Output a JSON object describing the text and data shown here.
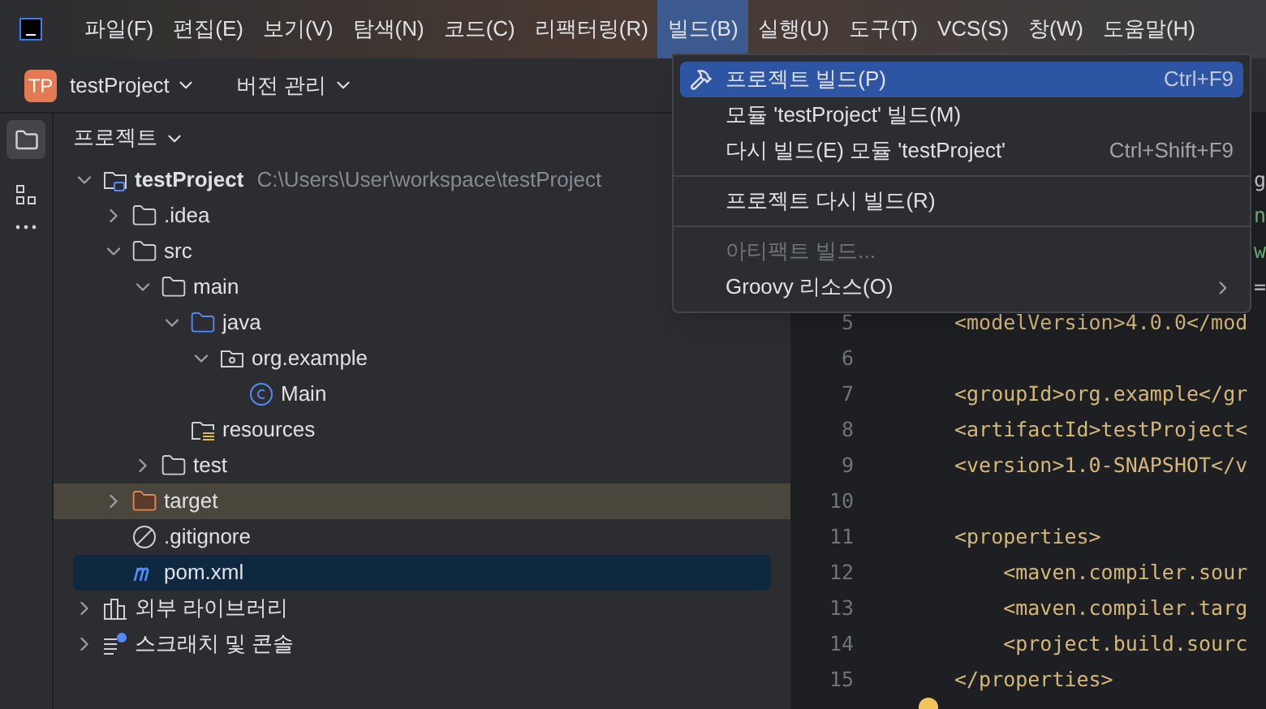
{
  "menu_bar": [
    {
      "label": "파일(F)",
      "selected": false
    },
    {
      "label": "편집(E)",
      "selected": false
    },
    {
      "label": "보기(V)",
      "selected": false
    },
    {
      "label": "탐색(N)",
      "selected": false
    },
    {
      "label": "코드(C)",
      "selected": false
    },
    {
      "label": "리팩터링(R)",
      "selected": false
    },
    {
      "label": "빌드(B)",
      "selected": true
    },
    {
      "label": "실행(U)",
      "selected": false
    },
    {
      "label": "도구(T)",
      "selected": false
    },
    {
      "label": "VCS(S)",
      "selected": false
    },
    {
      "label": "창(W)",
      "selected": false
    },
    {
      "label": "도움말(H)",
      "selected": false
    }
  ],
  "toolbar": {
    "project_badge": "TP",
    "project_name": "testProject",
    "vcs": "버전 관리"
  },
  "project_panel": {
    "title": "프로젝트",
    "tree": [
      {
        "name": "testProject",
        "path": "C:\\Users\\User\\workspace\\testProject",
        "kind": "module",
        "expanded": true,
        "selected": false,
        "excluded": false,
        "children": [
          {
            "name": ".idea",
            "kind": "folder",
            "expanded": false,
            "selected": false,
            "excluded": false
          },
          {
            "name": "src",
            "kind": "folder",
            "expanded": true,
            "selected": false,
            "excluded": false,
            "children": [
              {
                "name": "main",
                "kind": "folder",
                "expanded": true,
                "selected": false,
                "excluded": false,
                "children": [
                  {
                    "name": "java",
                    "kind": "source",
                    "expanded": true,
                    "selected": false,
                    "excluded": false,
                    "children": [
                      {
                        "name": "org.example",
                        "kind": "package",
                        "expanded": true,
                        "selected": false,
                        "excluded": false,
                        "children": [
                          {
                            "name": "Main",
                            "kind": "class",
                            "selected": false,
                            "excluded": false
                          }
                        ]
                      }
                    ]
                  },
                  {
                    "name": "resources",
                    "kind": "resources",
                    "selected": false,
                    "excluded": false
                  }
                ]
              },
              {
                "name": "test",
                "kind": "folder",
                "expanded": false,
                "selected": false,
                "excluded": false
              }
            ]
          },
          {
            "name": "target",
            "kind": "excluded",
            "expanded": false,
            "selected": false,
            "excluded": true
          },
          {
            "name": ".gitignore",
            "kind": "ignore",
            "selected": false,
            "excluded": false
          },
          {
            "name": "pom.xml",
            "kind": "maven",
            "selected": true,
            "excluded": false
          }
        ]
      },
      {
        "name": "외부 라이브러리",
        "kind": "library",
        "expanded": false,
        "selected": false,
        "excluded": false
      },
      {
        "name": "스크래치 및 콘솔",
        "kind": "scratch",
        "expanded": false,
        "selected": false,
        "excluded": false
      }
    ]
  },
  "editor": {
    "lines": [
      {
        "text": "g",
        "kind": "fragment"
      },
      {
        "text": "n",
        "kind": "fragment-green"
      },
      {
        "text": "w",
        "kind": "fragment-green"
      },
      {
        "text": "=",
        "kind": "fragment"
      },
      {
        "number": "5",
        "text": "<modelVersion>4.0.0</mod",
        "kind": "code"
      },
      {
        "number": "6",
        "kind": "code"
      },
      {
        "number": "7",
        "text": "<groupId>org.example</gr",
        "kind": "code"
      },
      {
        "number": "8",
        "text": "<artifactId>testProject<",
        "kind": "code"
      },
      {
        "number": "9",
        "text": "<version>1.0-SNAPSHOT</v",
        "kind": "code"
      },
      {
        "number": "10",
        "kind": "code"
      },
      {
        "number": "11",
        "text": "<properties>",
        "kind": "code"
      },
      {
        "number": "12",
        "text": "    <maven.compiler.sour",
        "kind": "code"
      },
      {
        "number": "13",
        "text": "    <maven.compiler.targ",
        "kind": "code"
      },
      {
        "number": "14",
        "text": "    <project.build.sourc",
        "kind": "code"
      },
      {
        "number": "15",
        "text": "</properties>",
        "kind": "code"
      }
    ]
  },
  "build_menu": [
    {
      "kind": "item",
      "label": "프로젝트 빌드(P)",
      "shortcut": "Ctrl+F9",
      "selected": true,
      "disabled": false
    },
    {
      "kind": "item",
      "label": "모듈 'testProject' 빌드(M)",
      "selected": false,
      "disabled": false
    },
    {
      "kind": "item",
      "label": "다시 빌드(E) 모듈 'testProject'",
      "shortcut": "Ctrl+Shift+F9",
      "selected": false,
      "disabled": false
    },
    {
      "kind": "separator"
    },
    {
      "kind": "item",
      "label": "프로젝트 다시 빌드(R)",
      "selected": false,
      "disabled": false
    },
    {
      "kind": "separator"
    },
    {
      "kind": "item",
      "label": "아티팩트 빌드...",
      "selected": false,
      "disabled": true
    },
    {
      "kind": "submenu",
      "label": "Groovy 리소스(O)",
      "selected": false,
      "disabled": false
    }
  ]
}
